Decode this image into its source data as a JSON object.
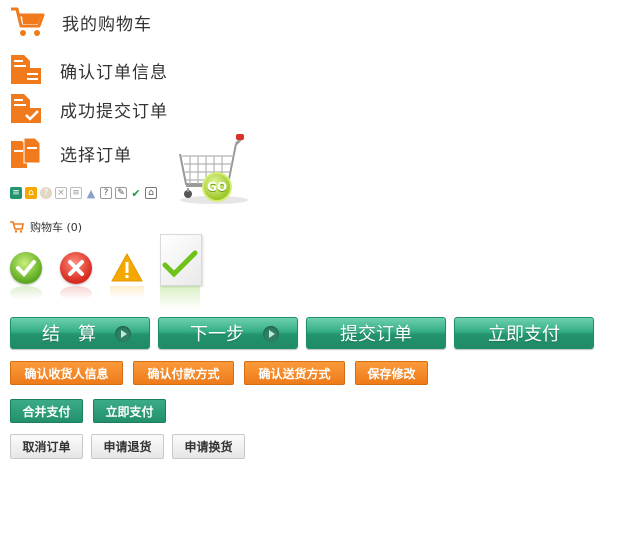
{
  "header": {
    "title": "我的购物车"
  },
  "steps": [
    {
      "label": "确认订单信息"
    },
    {
      "label": "成功提交订单"
    },
    {
      "label": "选择订单"
    }
  ],
  "cart_badge": "GO",
  "cart_count": "购物车 (0)",
  "big_buttons": [
    {
      "label": "结　算"
    },
    {
      "label": "下一步"
    },
    {
      "label": "提交订单"
    },
    {
      "label": "立即支付"
    }
  ],
  "orange_buttons": [
    {
      "label": "确认收货人信息"
    },
    {
      "label": "确认付款方式"
    },
    {
      "label": "确认送货方式"
    },
    {
      "label": "保存修改"
    }
  ],
  "green_buttons": [
    {
      "label": "合并支付"
    },
    {
      "label": "立即支付"
    }
  ],
  "gray_buttons": [
    {
      "label": "取消订单"
    },
    {
      "label": "申请退货"
    },
    {
      "label": "申请换货"
    }
  ],
  "colors": {
    "orange": "#ee7b1a",
    "green": "#22946e",
    "red": "#e0392b",
    "yellow": "#f5a800"
  }
}
